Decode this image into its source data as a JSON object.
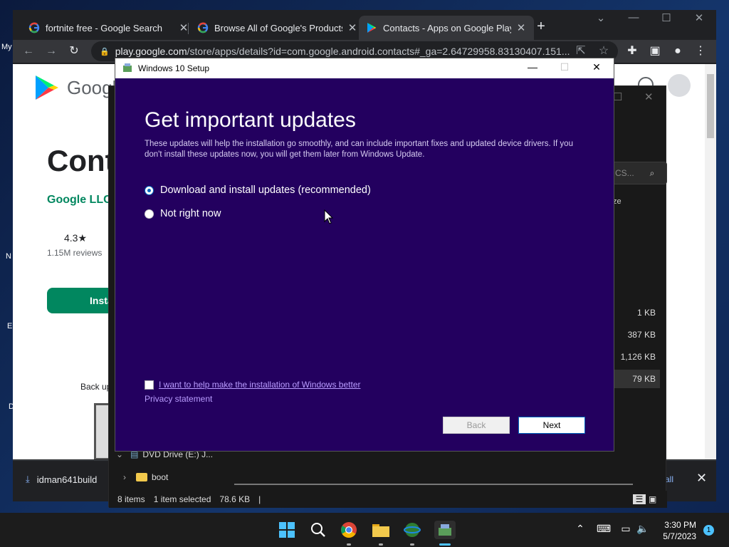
{
  "desktop": {
    "frag_my": "My",
    "frag_n": "N",
    "frag_e": "E",
    "frag_d": "D"
  },
  "chrome": {
    "tabs": [
      {
        "label": "fortnite free - Google Search",
        "favicon": "google-g-icon"
      },
      {
        "label": "Browse All of Google's Products",
        "favicon": "google-g-icon"
      },
      {
        "label": "Contacts - Apps on Google Play",
        "favicon": "google-play-icon"
      }
    ],
    "address": {
      "host": "play.google.com",
      "path": "/store/apps/details?id=com.google.android.contacts#_ga=2.64729958.83130407.151..."
    },
    "page": {
      "brand": "Google",
      "app_title": "Cont",
      "developer": "Google LLC",
      "rating": "4.3★",
      "reviews": "1.15M reviews",
      "install": "Insta",
      "backup": "Back up"
    },
    "download": {
      "filename": "idman641build",
      "show_all": "all"
    }
  },
  "explorer": {
    "search": "CS...",
    "col_size": "ze",
    "sizes": [
      "1 KB",
      "387 KB",
      "1,126 KB",
      "79 KB"
    ],
    "nav": [
      {
        "label": "DVD Drive (E:) J..."
      },
      {
        "label": "boot"
      }
    ],
    "status": {
      "items": "8 items",
      "selected": "1 item selected",
      "size": "78.6 KB"
    }
  },
  "setup": {
    "title": "Windows 10 Setup",
    "heading": "Get important updates",
    "description": "These updates will help the installation go smoothly, and can include important fixes and updated device drivers. If you don't install these updates now, you will get them later from Windows Update.",
    "options": [
      {
        "label": "Download and install updates (recommended)",
        "checked": true
      },
      {
        "label": "Not right now",
        "checked": false
      }
    ],
    "help_link": "I want to help make the installation of Windows better",
    "privacy": "Privacy statement",
    "back": "Back",
    "next": "Next"
  },
  "taskbar": {
    "time": "3:30 PM",
    "date": "5/7/2023",
    "notifications": "1"
  },
  "colors": {
    "setup_bg": "#23005f",
    "accent": "#0067c0",
    "play_green": "#01875f"
  }
}
